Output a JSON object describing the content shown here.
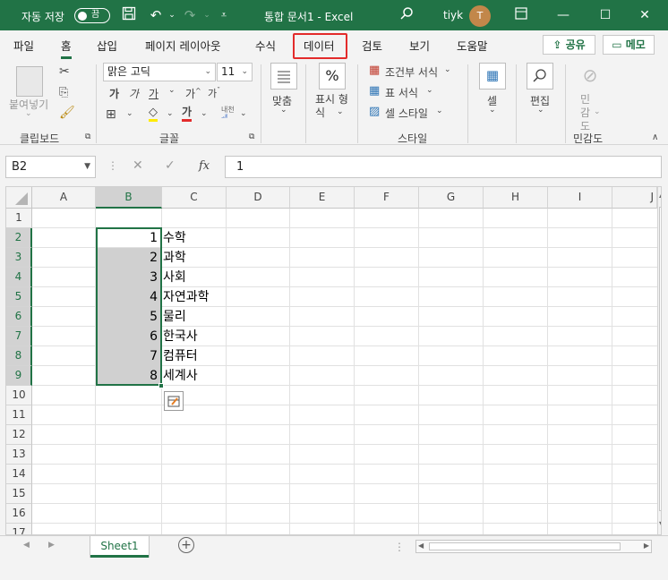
{
  "titlebar": {
    "autosave_label": "자동 저장",
    "autosave_state": "끔",
    "document_title": "통합 문서1  -  Excel",
    "user_name": "tiyk",
    "avatar_initial": "T"
  },
  "tabs": [
    "파일",
    "홈",
    "삽입",
    "페이지 레이아웃",
    "수식",
    "데이터",
    "검토",
    "보기",
    "도움말"
  ],
  "active_tab": "홈",
  "highlighted_tab": "데이터",
  "share_label": "공유",
  "memo_label": "메모",
  "ribbon": {
    "paste_label": "붙여넣기",
    "clipboard_group": "클립보드",
    "font_name": "맑은 고딕",
    "font_size": "11",
    "font_group": "글꼴",
    "align_label": "맞춤",
    "number_label": "표시 형식",
    "cond_format": "조건부 서식",
    "table_format": "표 서식",
    "cell_style": "셀 스타일",
    "style_group": "스타일",
    "cells_label": "셀",
    "edit_label": "편집",
    "sensitivity_label": "민감도",
    "sensitivity_group": "민감도"
  },
  "formula": {
    "name_box": "B2",
    "value": "1"
  },
  "columns": [
    "A",
    "B",
    "C",
    "D",
    "E",
    "F",
    "G",
    "H",
    "I",
    "J"
  ],
  "rows": [
    "1",
    "2",
    "3",
    "4",
    "5",
    "6",
    "7",
    "8",
    "9",
    "10",
    "11",
    "12",
    "13",
    "14",
    "15",
    "16",
    "17"
  ],
  "cells_B": [
    "1",
    "2",
    "3",
    "4",
    "5",
    "6",
    "7",
    "8"
  ],
  "cells_C": [
    "수학",
    "과학",
    "사회",
    "자연과학",
    "물리",
    "한국사",
    "컴퓨터",
    "세계사"
  ],
  "sheet_name": "Sheet1",
  "colors": {
    "excel_green": "#217346",
    "highlight_red": "#e32b2b",
    "selection_gray": "#d0d0d0"
  }
}
